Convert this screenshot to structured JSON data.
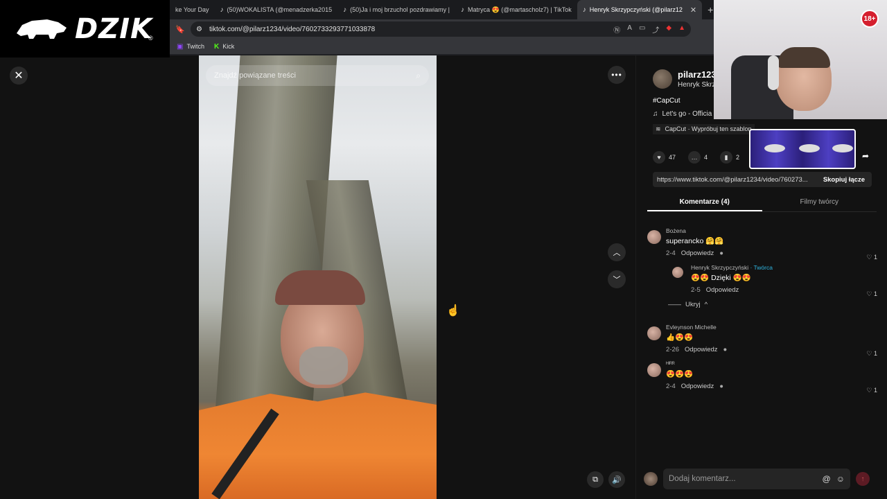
{
  "overlay": {
    "logo_text": "DZIK",
    "logo_reg": "®",
    "age_badge": "18+"
  },
  "browser": {
    "tabs": [
      {
        "label": "ke Your Day",
        "active": false
      },
      {
        "label": "(50)WOKALISTA (@menadzerka2015",
        "active": false
      },
      {
        "label": "(50)Ja i moj brzuchol pozdrawiamy |",
        "active": false
      },
      {
        "label": "Matryca 😍 (@martascholz7) | TikTok",
        "active": false
      },
      {
        "label": "Henryk Skrzypczyński (@pilarz12",
        "active": true
      }
    ],
    "url": "tiktok.com/@pilarz1234/video/7602733293771033878",
    "bookmarks": [
      "Twitch",
      "Kick"
    ]
  },
  "video": {
    "search_placeholder": "Znajdź powiązane treści"
  },
  "panel": {
    "author_handle": "pilarz123",
    "author_name": "Henryk Skrz",
    "description": "#CapCut",
    "music": "Let's go - Officia",
    "capcut": "CapCut · Wypróbuj ten szablon",
    "likes": "47",
    "comments_count": "4",
    "saves": "2",
    "link": "https://www.tiktok.com/@pilarz1234/video/760273...",
    "copy_label": "Skopiuj łącze",
    "tab_comments": "Komentarze (4)",
    "tab_creator": "Filmy twórcy"
  },
  "comments": [
    {
      "user": "Bożena",
      "text": "superancko 🤗🤗",
      "date": "2-4",
      "reply": "Odpowiedz",
      "likes": "1"
    },
    {
      "user": "Henryk Skrzypczyński",
      "badge": " · Twórca",
      "text": "😍😍 Dzięki 😍😍",
      "date": "2-5",
      "reply": "Odpowiedz",
      "likes": "1"
    },
    {
      "user": "Evleynson Michelle",
      "text": "👍😍😍",
      "date": "2-26",
      "reply": "Odpowiedz",
      "likes": "1"
    },
    {
      "user": "ᴴᴵᴿᴿ",
      "text": "😍😍😍",
      "date": "2-4",
      "reply": "Odpowiedz",
      "likes": "1"
    }
  ],
  "hide_label": "Ukryj",
  "comment_input_placeholder": "Dodaj komentarz..."
}
